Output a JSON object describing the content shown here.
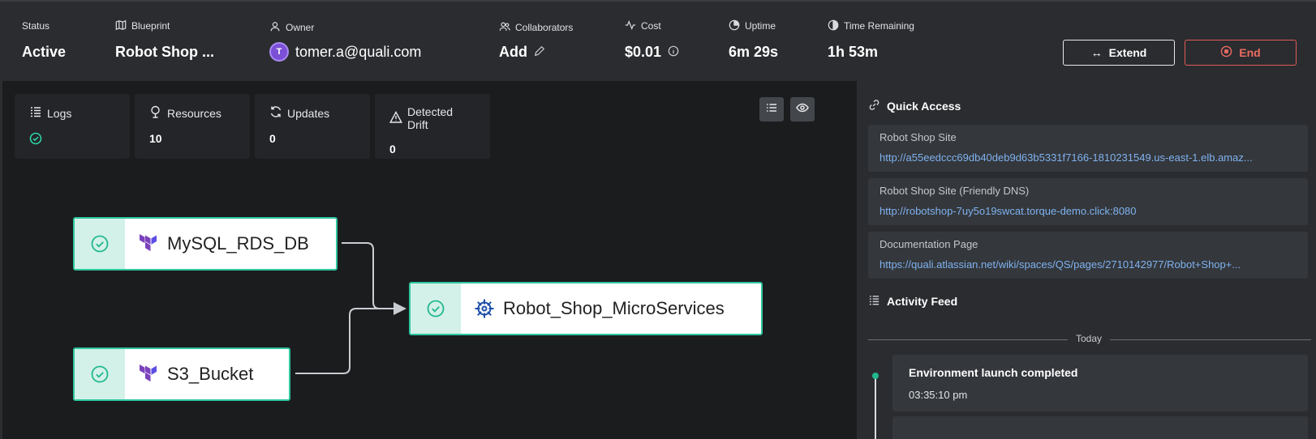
{
  "header": {
    "status": {
      "label": "Status",
      "value": "Active"
    },
    "blueprint": {
      "label": "Blueprint",
      "value": "Robot Shop ..."
    },
    "owner": {
      "label": "Owner",
      "avatar_initial": "T",
      "value": "tomer.a@quali.com"
    },
    "collaborators": {
      "label": "Collaborators",
      "value": "Add"
    },
    "cost": {
      "label": "Cost",
      "value": "$0.01"
    },
    "uptime": {
      "label": "Uptime",
      "value": "6m 29s"
    },
    "time_remaining": {
      "label": "Time Remaining",
      "value": "1h 53m"
    },
    "extend_label": "Extend",
    "end_label": "End"
  },
  "stats": [
    {
      "label": "Logs",
      "icon": "logs-icon"
    },
    {
      "label": "Resources",
      "value": "10"
    },
    {
      "label": "Updates",
      "value": "0"
    },
    {
      "label": "Detected Drift",
      "value": "0"
    }
  ],
  "graph": {
    "nodes": [
      {
        "name": "MySQL_RDS_DB",
        "type": "terraform-icon"
      },
      {
        "name": "S3_Bucket",
        "type": "terraform-icon"
      },
      {
        "name": "Robot_Shop_MicroServices",
        "type": "helm-icon"
      }
    ]
  },
  "quick_access": {
    "title": "Quick Access",
    "items": [
      {
        "title": "Robot Shop Site",
        "link": "http://a55eedccc69db40deb9d63b5331f7166-1810231549.us-east-1.elb.amaz..."
      },
      {
        "title": "Robot Shop Site (Friendly DNS)",
        "link": "http://robotshop-7uy5o19swcat.torque-demo.click:8080"
      },
      {
        "title": "Documentation Page",
        "link": "https://quali.atlassian.net/wiki/spaces/QS/pages/2710142977/Robot+Shop+..."
      }
    ]
  },
  "activity_feed": {
    "title": "Activity Feed",
    "day": "Today",
    "events": [
      {
        "title": "Environment launch completed",
        "time": "03:35:10 pm"
      }
    ]
  },
  "colors": {
    "accent": "#2ec7a0",
    "danger": "#e15b55",
    "link": "#7fb2f0",
    "terraform": "#7b42bc",
    "helm": "#0f1689"
  }
}
